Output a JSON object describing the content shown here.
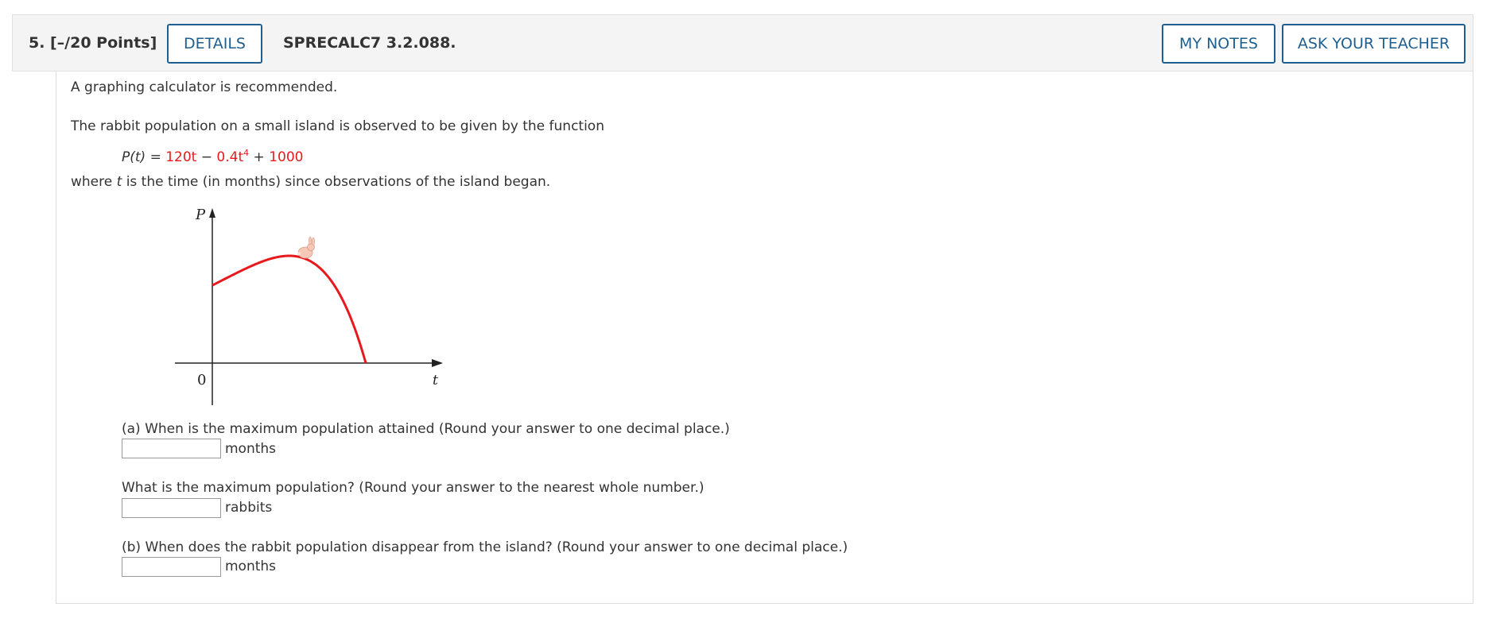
{
  "header": {
    "question_number": "5.",
    "points": "[–/20 Points]",
    "details_label": "DETAILS",
    "problem_code": "SPRECALC7 3.2.088.",
    "my_notes_label": "MY NOTES",
    "ask_teacher_label": "ASK YOUR TEACHER"
  },
  "body": {
    "calculator_note": "A graphing calculator is recommended.",
    "intro": "The rabbit population on a small island is observed to be given by the function",
    "equation": {
      "lhs": "P(t) = ",
      "term1": "120t",
      "minus": " − ",
      "term2_coef": "0.4t",
      "term2_exp": "4",
      "plus": " + ",
      "term3": "1000"
    },
    "where_pre": "where ",
    "where_var": "t",
    "where_post": " is the time (in months) since observations of the island began."
  },
  "graph": {
    "y_label": "P",
    "x_label": "t",
    "origin_label": "0",
    "curve_color": "#e8191d",
    "icon": "rabbit-icon"
  },
  "questions": [
    {
      "prompt": "(a) When is the maximum population attained (Round your answer to one decimal place.)",
      "value": "",
      "unit": "months"
    },
    {
      "prompt": "What is the maximum population? (Round your answer to the nearest whole number.)",
      "value": "",
      "unit": "rabbits"
    },
    {
      "prompt": "(b) When does the rabbit population disappear from the island? (Round your answer to one decimal place.)",
      "value": "",
      "unit": "months"
    }
  ]
}
